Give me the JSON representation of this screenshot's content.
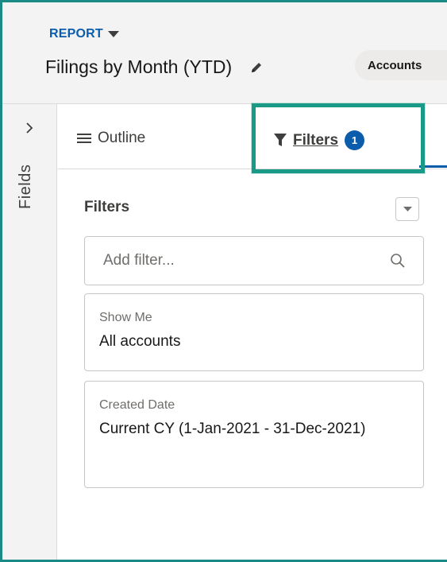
{
  "header": {
    "report_label": "REPORT",
    "title": "Filings by Month (YTD)",
    "chip_label": "Accounts"
  },
  "rail": {
    "label": "Fields"
  },
  "tabs": {
    "outline_label": "Outline",
    "filters_label": "Filters",
    "filters_count": "1"
  },
  "panel": {
    "title": "Filters",
    "search_placeholder": "Add filter...",
    "filters": [
      {
        "label": "Show Me",
        "value": "All accounts"
      },
      {
        "label": "Created Date",
        "value": "Current CY (1-Jan-2021 - 31-Dec-2021)"
      }
    ]
  },
  "colors": {
    "accent": "#0b5cab",
    "highlight_border": "#1a9a86",
    "frame_border": "#1a8a86",
    "header_bg": "#f3f3f3"
  },
  "icons": [
    "chevron-down-icon",
    "pencil-icon",
    "chevron-right-icon",
    "list-icon",
    "funnel-icon",
    "search-icon"
  ]
}
